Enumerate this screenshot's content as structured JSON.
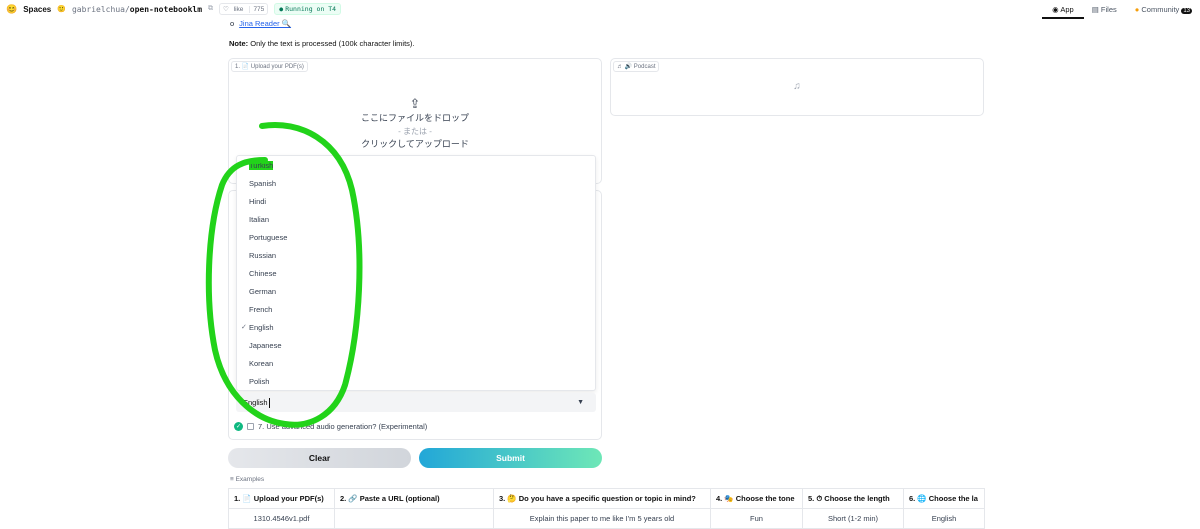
{
  "topbar": {
    "spaces_label": "Spaces",
    "owner": "gabrielchua",
    "separator": "/",
    "repo": "open-notebooklm",
    "like_label": "like",
    "like_count": "775",
    "running_label": "Running on T4",
    "tabs": [
      {
        "label": "App",
        "icon": "app-icon"
      },
      {
        "label": "Files",
        "icon": "files-icon"
      },
      {
        "label": "Community",
        "icon": "community-icon",
        "badge": "13"
      }
    ]
  },
  "jina": {
    "label": "Jina Reader 🔍"
  },
  "note": {
    "bold": "Note:",
    "text": " Only the text is processed (100k character limits)."
  },
  "upload": {
    "label": "1. 📄 Upload your PDF(s)",
    "drop_text": "ここにファイルをドロップ",
    "or_text": "- または -",
    "click_text": "クリックしてアップロード"
  },
  "podcast": {
    "label": "♬ 🔊 Podcast"
  },
  "languages": [
    "Turkish",
    "Spanish",
    "Hindi",
    "Italian",
    "Portuguese",
    "Russian",
    "Chinese",
    "German",
    "French",
    "English",
    "Japanese",
    "Korean",
    "Polish"
  ],
  "selected_language": "English",
  "advanced": {
    "label": "7. Use advanced audio generation? (Experimental)"
  },
  "buttons": {
    "clear": "Clear",
    "submit": "Submit"
  },
  "examples": {
    "label": "≡ Examples",
    "headers": [
      "1. 📄 Upload your PDF(s)",
      "2. 🔗 Paste a URL (optional)",
      "3. 🤔 Do you have a specific question or topic in mind?",
      "4. 🎭 Choose the tone",
      "5. ⏱ Choose the length",
      "6. 🌐 Choose the la"
    ],
    "rows": [
      [
        "1310.4546v1.pdf",
        "",
        "Explain this paper to me like I'm 5 years old",
        "Fun",
        "Short (1-2 min)",
        "English"
      ]
    ]
  },
  "colors": {
    "highlight": "#22d31a",
    "accent": "#10b981"
  }
}
